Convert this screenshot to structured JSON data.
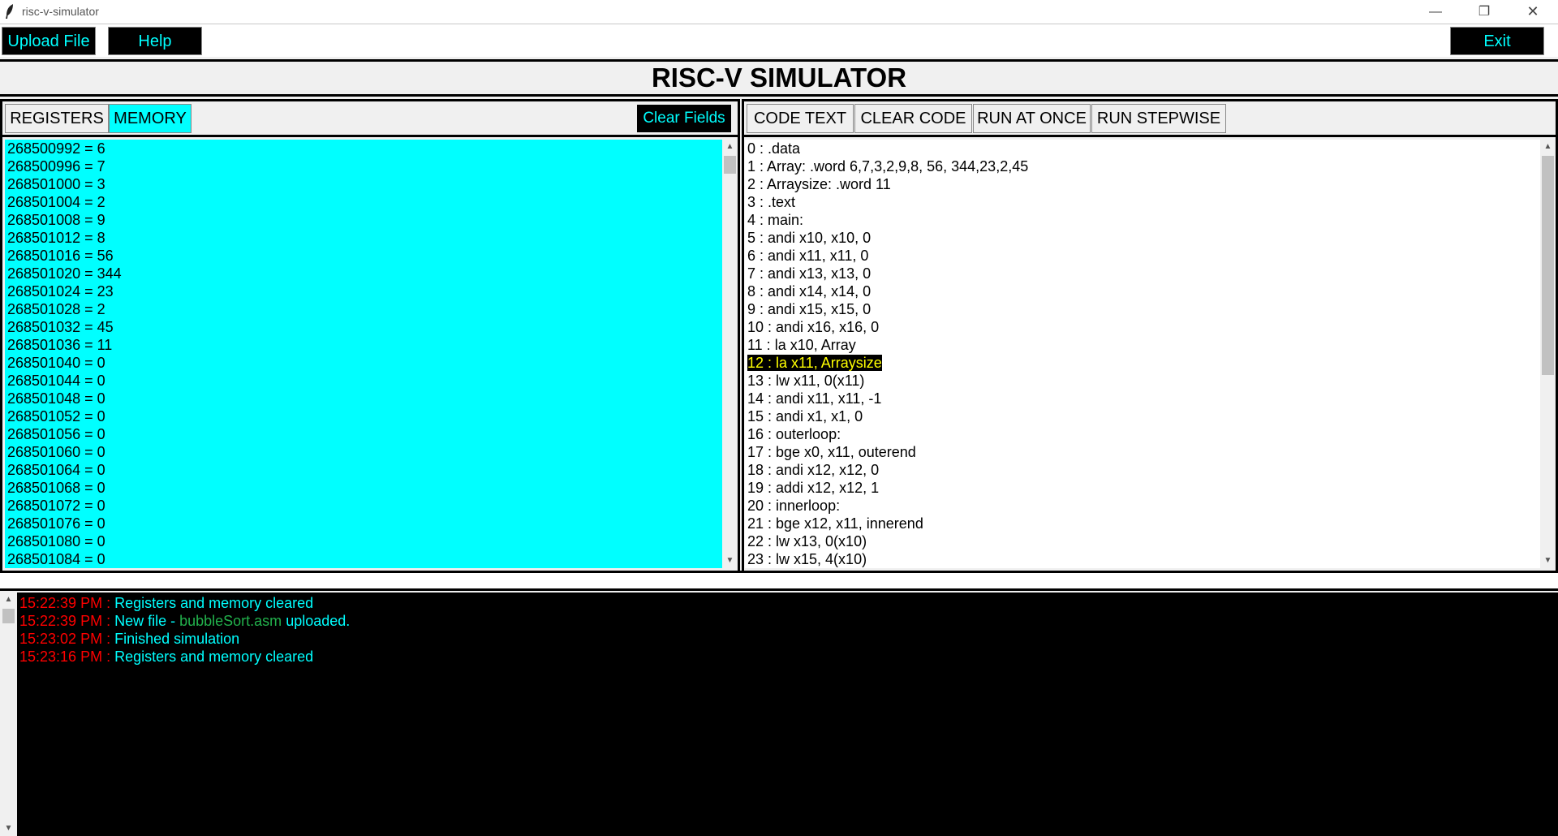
{
  "window": {
    "title": "risc-v-simulator",
    "minimize": "—",
    "maximize": "❐",
    "close": "✕"
  },
  "toolbar": {
    "upload_label": "Upload File",
    "help_label": "Help",
    "exit_label": "Exit"
  },
  "header": {
    "title": "RISC-V SIMULATOR"
  },
  "left_panel": {
    "tabs": [
      {
        "label": "REGISTERS"
      },
      {
        "label": "MEMORY"
      }
    ],
    "clear_fields_label": "Clear Fields",
    "memory": [
      "268500992 = 6",
      "268500996 = 7",
      "268501000 = 3",
      "268501004 = 2",
      "268501008 = 9",
      "268501012 = 8",
      "268501016 = 56",
      "268501020 = 344",
      "268501024 = 23",
      "268501028 = 2",
      "268501032 = 45",
      "268501036 = 11",
      "268501040 = 0",
      "268501044 = 0",
      "268501048 = 0",
      "268501052 = 0",
      "268501056 = 0",
      "268501060 = 0",
      "268501064 = 0",
      "268501068 = 0",
      "268501072 = 0",
      "268501076 = 0",
      "268501080 = 0",
      "268501084 = 0"
    ]
  },
  "right_panel": {
    "tabs": [
      {
        "label": "CODE TEXT"
      },
      {
        "label": "CLEAR CODE"
      },
      {
        "label": "RUN AT ONCE"
      },
      {
        "label": "RUN STEPWISE"
      }
    ],
    "highlighted_line": 12,
    "code": [
      "0 : .data",
      "1 : Array: .word 6,7,3,2,9,8, 56, 344,23,2,45",
      "2 : Arraysize: .word 11",
      "3 : .text",
      "4 : main:",
      "5 : andi x10, x10, 0",
      "6 : andi x11, x11, 0",
      "7 : andi x13, x13, 0",
      "8 : andi x14, x14, 0",
      "9 : andi x15, x15, 0",
      "10 : andi x16, x16, 0",
      "11 : la x10, Array",
      "12 : la x11, Arraysize",
      "13 : lw x11, 0(x11)",
      "14 : andi x11, x11, -1",
      "15 : andi x1, x1, 0",
      "16 : outerloop:",
      "17 : bge x0, x11, outerend",
      "18 : andi x12, x12, 0",
      "19 : addi x12, x12, 1",
      "20 : innerloop:",
      "21 : bge x12, x11, innerend",
      "22 : lw x13, 0(x10)",
      "23 : lw x15, 4(x10)"
    ]
  },
  "console": {
    "lines": [
      {
        "time": "15:22:39 PM :",
        "parts": [
          {
            "text": "Registers and memory cleared",
            "style": "msg"
          }
        ]
      },
      {
        "time": "15:22:39 PM :",
        "parts": [
          {
            "text": "New file - ",
            "style": "msg"
          },
          {
            "text": "bubbleSort.asm",
            "style": "file"
          },
          {
            "text": " uploaded.",
            "style": "msg"
          }
        ]
      },
      {
        "time": "15:23:02 PM :",
        "parts": [
          {
            "text": "Finished simulation",
            "style": "msg"
          }
        ]
      },
      {
        "time": "15:23:16 PM :",
        "parts": [
          {
            "text": "Registers and memory cleared",
            "style": "msg"
          }
        ]
      }
    ]
  },
  "colors": {
    "accent": "#00ffff",
    "button_bg": "#000000",
    "highlight_fg": "#ffff00",
    "time": "#ff0000",
    "file": "#22b14c"
  },
  "icons": {
    "app": "feather-icon",
    "scroll_up": "arrow-up-icon",
    "scroll_down": "arrow-down-icon"
  }
}
